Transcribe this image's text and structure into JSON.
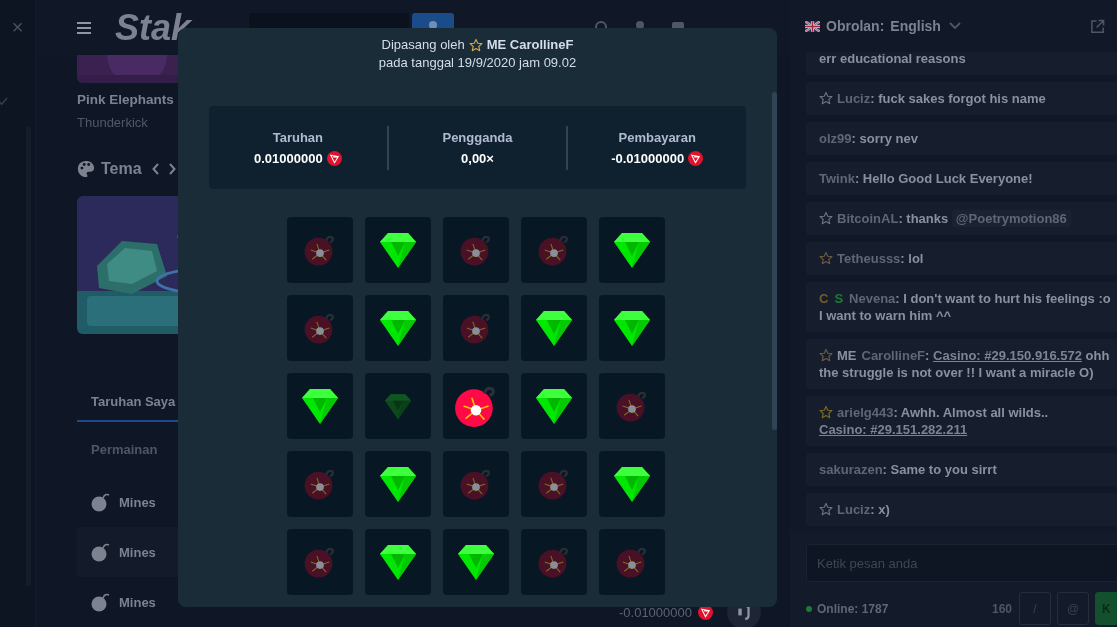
{
  "sidebar": {
    "close": "×"
  },
  "header": {
    "logo": "Stak"
  },
  "game": {
    "title": "Pink Elephants",
    "provider": "Thunderkick"
  },
  "themes": {
    "title": "Tema"
  },
  "bets": {
    "tabs": [
      {
        "label": "Taruhan Saya",
        "selected": true
      }
    ],
    "filter": "Permainan",
    "rows": [
      {
        "game": "Mines"
      },
      {
        "game": "Mines"
      },
      {
        "game": "Mines",
        "payout": "-0.01000000"
      }
    ]
  },
  "modal": {
    "placed_by": "Dipasang oleh",
    "rank": "ME",
    "user": "CarollineF",
    "date_line": "pada tanggal 19/9/2020 jam 09.02",
    "stats": [
      {
        "label": "Taruhan",
        "value": "0.01000000",
        "currency": true
      },
      {
        "label": "Pengganda",
        "value": "0,00×",
        "currency": false
      },
      {
        "label": "Pembayaran",
        "value": "-0.01000000",
        "currency": true
      }
    ],
    "tiles": [
      {
        "kind": "mine",
        "picked": false
      },
      {
        "kind": "gem",
        "picked": true
      },
      {
        "kind": "mine",
        "picked": false
      },
      {
        "kind": "mine",
        "picked": false
      },
      {
        "kind": "gem",
        "picked": true
      },
      {
        "kind": "mine",
        "picked": false
      },
      {
        "kind": "gem",
        "picked": true
      },
      {
        "kind": "mine",
        "picked": false
      },
      {
        "kind": "gem",
        "picked": true
      },
      {
        "kind": "gem",
        "picked": true
      },
      {
        "kind": "gem",
        "picked": true
      },
      {
        "kind": "gem",
        "picked": false
      },
      {
        "kind": "mine",
        "picked": true
      },
      {
        "kind": "gem",
        "picked": true
      },
      {
        "kind": "mine",
        "picked": false
      },
      {
        "kind": "mine",
        "picked": false
      },
      {
        "kind": "gem",
        "picked": true
      },
      {
        "kind": "mine",
        "picked": false
      },
      {
        "kind": "mine",
        "picked": false
      },
      {
        "kind": "gem",
        "picked": true
      },
      {
        "kind": "mine",
        "picked": false
      },
      {
        "kind": "gem",
        "picked": true
      },
      {
        "kind": "gem",
        "picked": true
      },
      {
        "kind": "mine",
        "picked": false
      },
      {
        "kind": "mine",
        "picked": false
      }
    ]
  },
  "chat": {
    "title": "Obrolan:",
    "language": "English",
    "messages": [
      {
        "star": false,
        "segments": [
          {
            "kind": "text",
            "text": "err educational reasons"
          }
        ]
      },
      {
        "star": true,
        "color": "#6b7385",
        "segments": [
          {
            "kind": "user",
            "text": "Luciz"
          },
          {
            "kind": "text",
            "text": ": fuck sakes forgot his name"
          }
        ]
      },
      {
        "star": false,
        "segments": [
          {
            "kind": "user",
            "text": "olz99"
          },
          {
            "kind": "text",
            "text": ": sorry nev"
          }
        ]
      },
      {
        "star": false,
        "segments": [
          {
            "kind": "user",
            "text": "Twink"
          },
          {
            "kind": "text",
            "text": ": Hello Good Luck Everyone!"
          }
        ]
      },
      {
        "star": true,
        "color": "#6b7385",
        "segments": [
          {
            "kind": "user",
            "text": "BitcoinAL"
          },
          {
            "kind": "text",
            "text": ": thanks "
          },
          {
            "kind": "mention",
            "text": "@Poetrymotion86"
          }
        ]
      },
      {
        "star": true,
        "color": "#6e5a3e",
        "segments": [
          {
            "kind": "user",
            "text": "Tetheusss"
          },
          {
            "kind": "text",
            "text": ": lol"
          }
        ]
      },
      {
        "star": false,
        "segments": [
          {
            "kind": "badge",
            "text": "C",
            "color": "#7a5a2c"
          },
          {
            "kind": "badge",
            "text": "S",
            "color": "#1f7a3a"
          },
          {
            "kind": "user",
            "text": "Nevena"
          },
          {
            "kind": "text",
            "text": ": I don't want to hurt his feelings :o I want to warn him ^^"
          }
        ]
      },
      {
        "star": true,
        "color": "#6e5a3e",
        "segments": [
          {
            "kind": "rank",
            "text": "ME"
          },
          {
            "kind": "user",
            "text": "CarollineF"
          },
          {
            "kind": "text",
            "text": ": "
          },
          {
            "kind": "link",
            "text": "Casino: #29.150.916.572"
          },
          {
            "kind": "text",
            "text": " ohh the struggle is not over !! I want a miracle O)"
          }
        ]
      },
      {
        "star": true,
        "color": "#7d6a22",
        "segments": [
          {
            "kind": "user",
            "text": "arielg443"
          },
          {
            "kind": "text",
            "text": ": Awhh. Almost all wilds.. "
          },
          {
            "kind": "link",
            "text": "Casino: #29.151.282.211"
          }
        ]
      },
      {
        "star": false,
        "segments": [
          {
            "kind": "user",
            "text": "sakurazen"
          },
          {
            "kind": "text",
            "text": ": Same to you sirrt"
          }
        ]
      },
      {
        "star": true,
        "color": "#6b7385",
        "segments": [
          {
            "kind": "user",
            "text": "Luciz"
          },
          {
            "kind": "text",
            "text": ": x)"
          }
        ]
      }
    ],
    "input": {
      "placeholder": "Ketik pesan anda"
    },
    "online": "Online: 1787",
    "char_count": "160",
    "buttons": [
      {
        "kind": "plain",
        "label": "/"
      },
      {
        "kind": "plain",
        "label": "@"
      },
      {
        "kind": "send",
        "label": "K"
      }
    ]
  }
}
